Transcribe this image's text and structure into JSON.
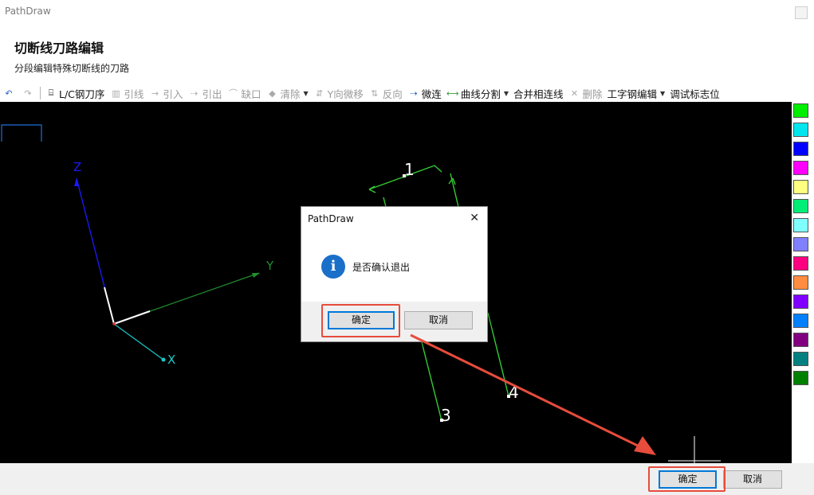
{
  "window": {
    "title": "PathDraw"
  },
  "header": {
    "title": "切断线刀路编辑",
    "subtitle": "分段编辑特殊切断线的刀路"
  },
  "toolbar": {
    "items": [
      {
        "label": "",
        "icon": "undo-icon",
        "enabled": true
      },
      {
        "label": "",
        "icon": "redo-icon",
        "enabled": false
      },
      {
        "label": "L/C钢刀序",
        "icon": "blade-order-icon",
        "enabled": true
      },
      {
        "label": "引线",
        "icon": "lead-line-icon",
        "enabled": false
      },
      {
        "label": "引入",
        "icon": "lead-in-icon",
        "enabled": false
      },
      {
        "label": "引出",
        "icon": "lead-out-icon",
        "enabled": false
      },
      {
        "label": "缺口",
        "icon": "notch-icon",
        "enabled": false
      },
      {
        "label": "清除",
        "icon": "clear-icon",
        "enabled": false,
        "dropdown": true
      },
      {
        "label": "Y向微移",
        "icon": "y-nudge-icon",
        "enabled": false
      },
      {
        "label": "反向",
        "icon": "reverse-icon",
        "enabled": false
      },
      {
        "label": "微连",
        "icon": "micro-joint-icon",
        "enabled": true
      },
      {
        "label": "曲线分割",
        "icon": "curve-split-icon",
        "enabled": true,
        "dropdown": true
      },
      {
        "label": "合并相连线",
        "icon": "",
        "enabled": true
      },
      {
        "label": "删除",
        "icon": "delete-icon",
        "enabled": false
      },
      {
        "label": "工字钢编辑",
        "icon": "",
        "enabled": true,
        "dropdown": true
      },
      {
        "label": "调试标志位",
        "icon": "",
        "enabled": true
      }
    ]
  },
  "canvas": {
    "axes": {
      "z": "Z",
      "y": "Y",
      "x": "X"
    },
    "point_labels": [
      "1",
      "3",
      "4"
    ]
  },
  "palette": {
    "colors": [
      "#00ee00",
      "#00e5ee",
      "#0000ff",
      "#ff00ff",
      "#ffff80",
      "#00ee76",
      "#80ffff",
      "#8080ff",
      "#ff0080",
      "#ff8c40",
      "#8000ff",
      "#0080ff",
      "#800080",
      "#008080",
      "#008000"
    ]
  },
  "footer": {
    "ok_label": "确定",
    "cancel_label": "取消"
  },
  "dialog": {
    "title": "PathDraw",
    "message": "是否确认退出",
    "ok_label": "确定",
    "cancel_label": "取消",
    "icon": "info-icon"
  },
  "annotation": {
    "color": "#e74c3c"
  }
}
